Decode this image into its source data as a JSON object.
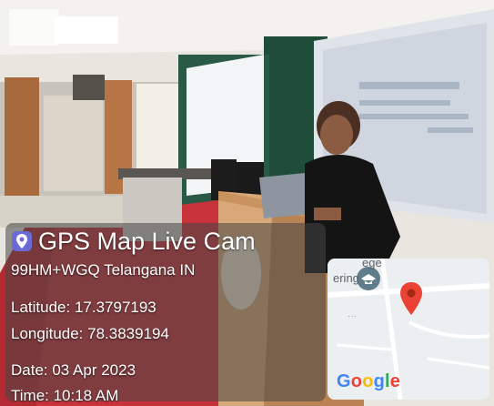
{
  "overlay": {
    "app_name": "GPS Map Live Cam",
    "plus_code_location": "99HM+WGQ  Telangana IN",
    "latitude": "Latitude: 17.3797193",
    "longitude": "Longitude: 78.3839194",
    "date": "Date: 03 Apr 2023",
    "time": "Time: 10:18 AM"
  },
  "map": {
    "label_partial_1": "ege",
    "label_partial_2": "ering",
    "brand": "Google",
    "brand_colors": [
      "#4285F4",
      "#EA4335",
      "#FBBC05",
      "#4285F4",
      "#34A853",
      "#EA4335"
    ],
    "marker_color": "#EA4335",
    "education_marker_color": "#607D8B"
  },
  "scene": {
    "description_colors": {
      "stage_carpet": "#c8333b",
      "projector_screen": "#dfe3ea",
      "wall": "#f1ede6",
      "podium": "#b98353",
      "curtain_green": "#1f4d3a"
    }
  }
}
